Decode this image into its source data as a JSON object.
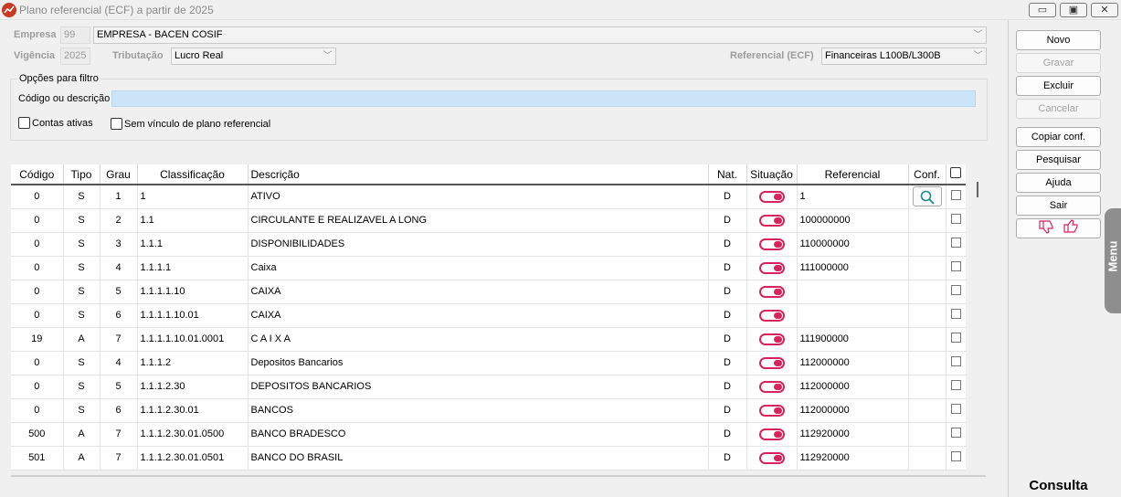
{
  "window": {
    "title": "Plano referencial (ECF) a partir de 2025",
    "minimize_icon": "minimize-icon",
    "restore_icon": "restore-icon",
    "close_icon": "close-icon"
  },
  "form": {
    "empresa_label": "Empresa",
    "empresa_code": "99",
    "empresa_name": "EMPRESA - BACEN COSIF",
    "vigencia_label": "Vigência",
    "vigencia_value": "2025",
    "tributacao_label": "Tributação",
    "tributacao_value": "Lucro Real",
    "referencial_label": "Referencial (ECF)",
    "referencial_value": "Financeiras L100B/L300B"
  },
  "filter": {
    "group_title": "Opções para filtro",
    "search_label": "Código ou descrição",
    "search_value": "",
    "contas_ativas_label": "Contas ativas",
    "sem_vinculo_label": "Sem vínculo de plano referencial"
  },
  "grid": {
    "columns": [
      "Código",
      "Tipo",
      "Grau",
      "Classificação",
      "Descrição",
      "Nat.",
      "Situação",
      "Referencial",
      "Conf."
    ],
    "rows": [
      {
        "codigo": "0",
        "tipo": "S",
        "grau": "1",
        "classificacao": "1",
        "descricao": "ATIVO",
        "nat": "D",
        "referencial": "1"
      },
      {
        "codigo": "0",
        "tipo": "S",
        "grau": "2",
        "classificacao": "1.1",
        "descricao": "CIRCULANTE E REALIZAVEL A LONG",
        "nat": "D",
        "referencial": "100000000"
      },
      {
        "codigo": "0",
        "tipo": "S",
        "grau": "3",
        "classificacao": "1.1.1",
        "descricao": "DISPONIBILIDADES",
        "nat": "D",
        "referencial": "110000000"
      },
      {
        "codigo": "0",
        "tipo": "S",
        "grau": "4",
        "classificacao": "1.1.1.1",
        "descricao": "Caixa",
        "nat": "D",
        "referencial": "111000000"
      },
      {
        "codigo": "0",
        "tipo": "S",
        "grau": "5",
        "classificacao": "1.1.1.1.10",
        "descricao": "CAIXA",
        "nat": "D",
        "referencial": ""
      },
      {
        "codigo": "0",
        "tipo": "S",
        "grau": "6",
        "classificacao": "1.1.1.1.10.01",
        "descricao": "CAIXA",
        "nat": "D",
        "referencial": ""
      },
      {
        "codigo": "19",
        "tipo": "A",
        "grau": "7",
        "classificacao": "1.1.1.1.10.01.0001",
        "descricao": "C A I X A",
        "nat": "D",
        "referencial": "111900000"
      },
      {
        "codigo": "0",
        "tipo": "S",
        "grau": "4",
        "classificacao": "1.1.1.2",
        "descricao": "Depositos Bancarios",
        "nat": "D",
        "referencial": "112000000"
      },
      {
        "codigo": "0",
        "tipo": "S",
        "grau": "5",
        "classificacao": "1.1.1.2.30",
        "descricao": "DEPOSITOS BANCARIOS",
        "nat": "D",
        "referencial": "112000000"
      },
      {
        "codigo": "0",
        "tipo": "S",
        "grau": "6",
        "classificacao": "1.1.1.2.30.01",
        "descricao": "BANCOS",
        "nat": "D",
        "referencial": "112000000"
      },
      {
        "codigo": "500",
        "tipo": "A",
        "grau": "7",
        "classificacao": "1.1.1.2.30.01.0500",
        "descricao": "BANCO BRADESCO",
        "nat": "D",
        "referencial": "112920000"
      },
      {
        "codigo": "501",
        "tipo": "A",
        "grau": "7",
        "classificacao": "1.1.1.2.30.01.0501",
        "descricao": "BANCO DO BRASIL",
        "nat": "D",
        "referencial": "112920000"
      }
    ]
  },
  "sidebar": {
    "novo": "Novo",
    "gravar": "Gravar",
    "excluir": "Excluir",
    "cancelar": "Cancelar",
    "copiar": "Copiar conf.",
    "pesquisar": "Pesquisar",
    "ajuda": "Ajuda",
    "sair": "Sair",
    "feedback_icons": [
      "thumbs-down-icon",
      "thumbs-up-icon"
    ],
    "menu_tab": "Menu",
    "status": "Consulta"
  },
  "colors": {
    "toggle_accent": "#d6245c",
    "search_highlight": "#cce4f7",
    "app_icon": "#c83a22"
  }
}
